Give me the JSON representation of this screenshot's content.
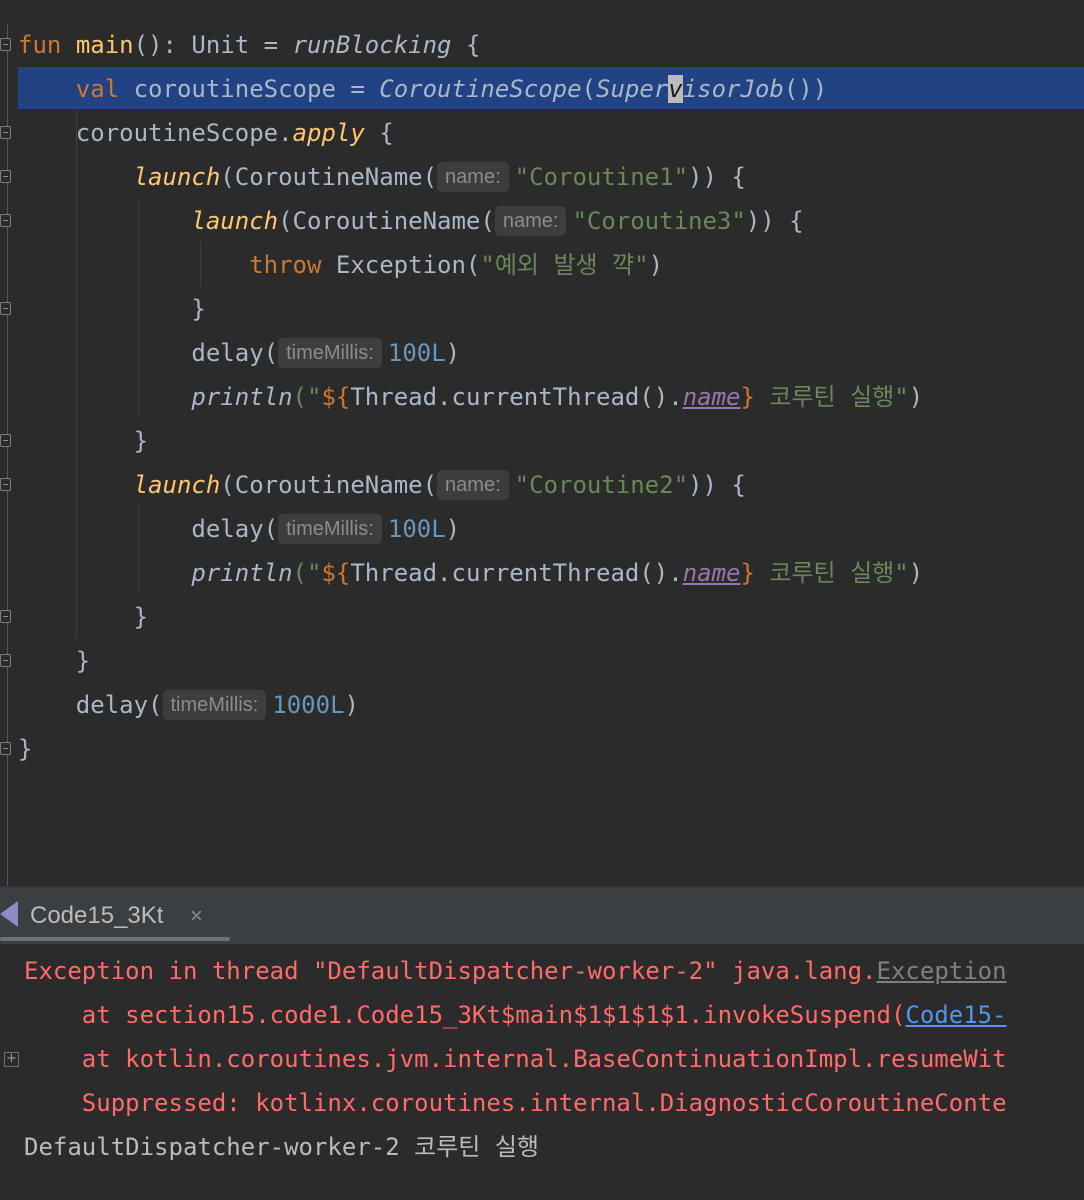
{
  "editor": {
    "line1": {
      "kw": "fun",
      "fn": "main",
      "sig": "(): Unit = ",
      "builder": "runBlocking",
      "brace": " {"
    },
    "line2": {
      "kw": "val",
      "name": " coroutineScope = ",
      "ctor": "CoroutineScope",
      "open": "(",
      "sup_a": "Super",
      "sup_caret": "v",
      "sup_b": "isorJob",
      "close": "())"
    },
    "line3": {
      "recv": "coroutineScope.",
      "ext": "apply",
      "brace": " {"
    },
    "line4": {
      "launch": "launch",
      "open": "(CoroutineName(",
      "hint": "name:",
      "str": "\"Coroutine1\"",
      "close": ")) {"
    },
    "line5": {
      "launch": "launch",
      "open": "(CoroutineName(",
      "hint": "name:",
      "str": "\"Coroutine3\"",
      "close": ")) {"
    },
    "line6": {
      "kw": "throw",
      "rest": " Exception(",
      "str": "\"예외 발생 꺅\"",
      "close": ")"
    },
    "line7": {
      "brace": "}"
    },
    "line8": {
      "fn": "delay(",
      "hint": "timeMillis:",
      "num": "100L",
      "close": ")"
    },
    "line9": {
      "fn": "println",
      "q1": "(\"",
      "tmpl_open": "${",
      "expr": "Thread.currentThread().",
      "prop": "name",
      "tmpl_close": "}",
      "str": " 코루틴 실행\"",
      "close": ")"
    },
    "line10": {
      "brace": "}"
    },
    "line11": {
      "launch": "launch",
      "open": "(CoroutineName(",
      "hint": "name:",
      "str": "\"Coroutine2\"",
      "close": ")) {"
    },
    "line12": {
      "fn": "delay(",
      "hint": "timeMillis:",
      "num": "100L",
      "close": ")"
    },
    "line13": {
      "fn": "println",
      "q1": "(\"",
      "tmpl_open": "${",
      "expr": "Thread.currentThread().",
      "prop": "name",
      "tmpl_close": "}",
      "str": " 코루틴 실행\"",
      "close": ")"
    },
    "line14": {
      "brace": "}"
    },
    "line15": {
      "brace": "}"
    },
    "line16": {
      "fn": "delay(",
      "hint": "timeMillis:",
      "num": "1000L",
      "close": ")"
    },
    "line17": {
      "brace": "}"
    }
  },
  "run_panel": {
    "tab_title": "Code15_3Kt",
    "close_glyph": "×",
    "icon": "run-config-icon"
  },
  "console": {
    "l1_a": "Exception in thread \"DefaultDispatcher-worker-2\" java.lang.",
    "l1_link": "Exception",
    "l2_a": "    at section15.code1.Code15_3Kt$main$1$1$1$1.invokeSuspend(",
    "l2_link": "Code15-",
    "l3": "    at kotlin.coroutines.jvm.internal.BaseContinuationImpl.resumeWit",
    "l4": "    Suppressed: kotlinx.coroutines.internal.DiagnosticCoroutineConte",
    "l5": "DefaultDispatcher-worker-2 코루틴 실행",
    "expand_glyph": "+"
  },
  "colors": {
    "background": "#2b2b2b",
    "selection": "#214283",
    "keyword": "#cc7832",
    "function": "#ffc66d",
    "string": "#6a8759",
    "number": "#6897bb",
    "error": "#ff6b68",
    "link": "#5394ec"
  }
}
